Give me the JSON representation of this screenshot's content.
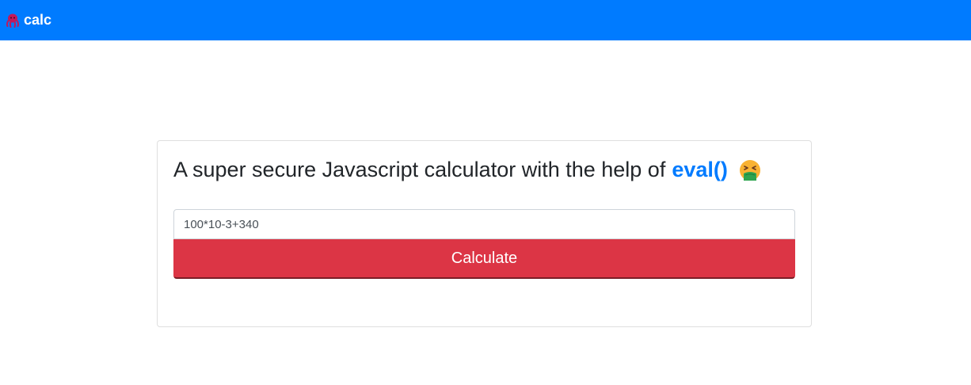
{
  "navbar": {
    "brand_label": "calc",
    "brand_icon": "octopus-icon",
    "bg_color": "#007bff"
  },
  "card": {
    "title_text": "A super secure Javascript calculator with the help of",
    "title_link": "eval()",
    "title_emoji": "nauseated-face-icon",
    "link_color": "#007bff"
  },
  "form": {
    "input_value": "100*10-3+340",
    "button_label": "Calculate",
    "button_color": "#dc3545"
  }
}
